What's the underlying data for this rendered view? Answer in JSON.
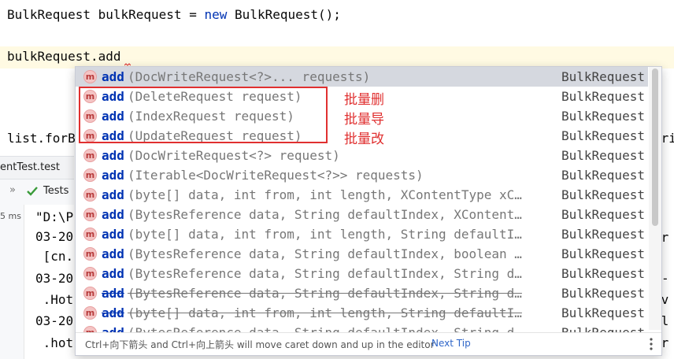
{
  "editor": {
    "line1": {
      "type": "BulkRequest",
      "var": "bulkRequest",
      "eq": "=",
      "kw_new": "new",
      "ctor": "BulkRequest();"
    },
    "line2": "bulkRequest.add",
    "line3_left": "list.forB",
    "line3_right": "tri"
  },
  "bottom_panel": {
    "tab_label": "entTest.test",
    "tests_label": "Tests",
    "gutter_time": "5 ms",
    "console_lines": [
      "\"D:\\P",
      "03-20",
      " [cn.",
      "03-20",
      " .Hot",
      "03-20",
      " .hot"
    ],
    "right_fragments": [
      "er",
      "-",
      "ov",
      "il",
      "pr"
    ]
  },
  "completion": {
    "items": [
      {
        "name": "add",
        "params": "(DocWriteRequest<?>... requests)",
        "type": "BulkRequest",
        "selected": true
      },
      {
        "name": "add",
        "params": "(DeleteRequest request)",
        "type": "BulkRequest"
      },
      {
        "name": "add",
        "params": "(IndexRequest request)",
        "type": "BulkRequest"
      },
      {
        "name": "add",
        "params": "(UpdateRequest request)",
        "type": "BulkRequest"
      },
      {
        "name": "add",
        "params": "(DocWriteRequest<?> request)",
        "type": "BulkRequest"
      },
      {
        "name": "add",
        "params": "(Iterable<DocWriteRequest<?>> requests)",
        "type": "BulkRequest"
      },
      {
        "name": "add",
        "params": "(byte[] data, int from, int length, XContentType xC…",
        "type": "BulkRequest"
      },
      {
        "name": "add",
        "params": "(BytesReference data, String defaultIndex, XContent…",
        "type": "BulkRequest"
      },
      {
        "name": "add",
        "params": "(byte[] data, int from, int length, String defaultI…",
        "type": "BulkRequest"
      },
      {
        "name": "add",
        "params": "(BytesReference data, String defaultIndex, boolean …",
        "type": "BulkRequest"
      },
      {
        "name": "add",
        "params": "(BytesReference data, String defaultIndex, String d…",
        "type": "BulkRequest"
      },
      {
        "name": "add",
        "params": "(BytesReference data, String defaultIndex, String d…",
        "type": "BulkRequest",
        "deprecated": true
      },
      {
        "name": "add",
        "params": "(byte[] data, int from, int length, String defaultI…",
        "type": "BulkRequest",
        "deprecated": true
      },
      {
        "name": "add",
        "params": "(BytesReference data, String defaultIndex, String d…",
        "type": "BulkRequest",
        "deprecated": true
      }
    ],
    "icon_letter": "m",
    "footer_hint": "Ctrl+向下箭头 and Ctrl+向上箭头 will move caret down and up in the editor",
    "footer_tip": "Next Tip"
  },
  "annotations": [
    "批量删",
    "批量导",
    "批量改"
  ],
  "colors": {
    "keyword": "#0033b3",
    "annotation": "#e03030",
    "method_icon_bg": "#f4c4c4",
    "tip_link": "#2f66c9",
    "selected_row": "#d5d8df"
  }
}
